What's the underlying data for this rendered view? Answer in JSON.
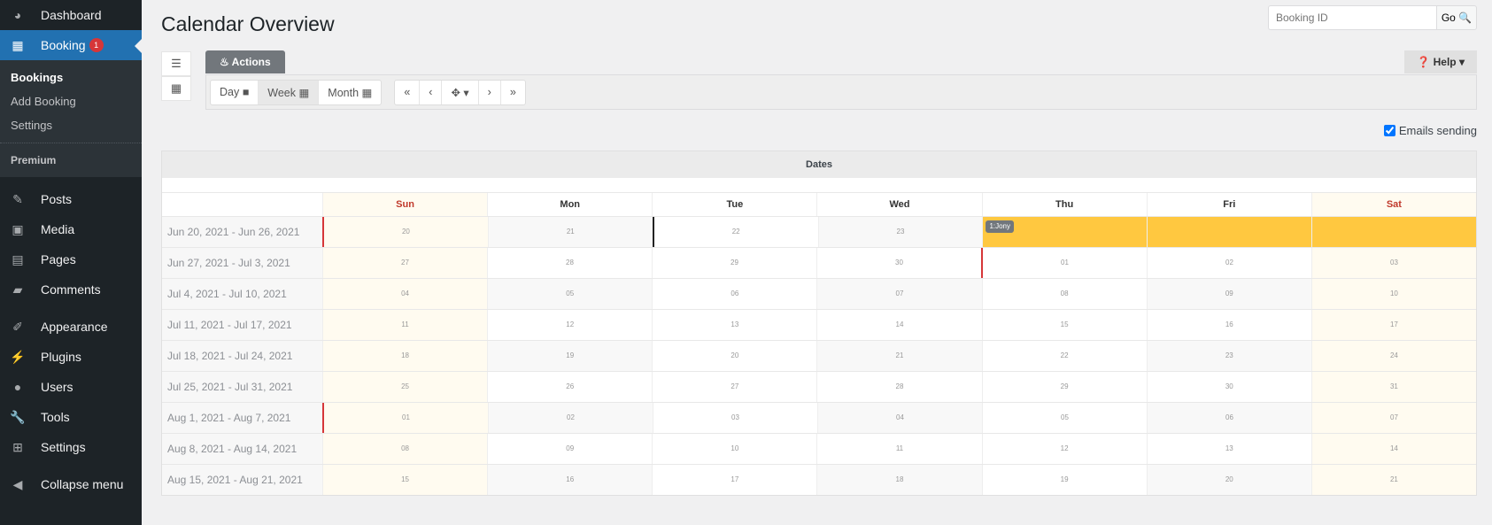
{
  "sidebar": {
    "top": [
      {
        "label": "Dashboard",
        "icon": "dashboard-icon",
        "glyph": "◕"
      }
    ],
    "booking": {
      "label": "Booking",
      "badge": "1"
    },
    "sub": [
      "Bookings",
      "Add Booking",
      "Settings"
    ],
    "premium": "Premium",
    "items": [
      {
        "label": "Posts",
        "glyph": "✎"
      },
      {
        "label": "Media",
        "glyph": "▣"
      },
      {
        "label": "Pages",
        "glyph": "▤"
      },
      {
        "label": "Comments",
        "glyph": "▰"
      },
      {
        "label": "Appearance",
        "glyph": "✐"
      },
      {
        "label": "Plugins",
        "glyph": "⚡"
      },
      {
        "label": "Users",
        "glyph": "●"
      },
      {
        "label": "Tools",
        "glyph": "🔧"
      },
      {
        "label": "Settings",
        "glyph": "⊞"
      },
      {
        "label": "Collapse menu",
        "glyph": "◀"
      }
    ]
  },
  "header": {
    "title": "Calendar Overview",
    "search_placeholder": "Booking ID",
    "go": "Go 🔍"
  },
  "toolbar": {
    "actions": "♨ Actions",
    "help": "❓ Help ▾",
    "views": [
      {
        "label": "Day ■",
        "selected": false
      },
      {
        "label": "Week ▦",
        "selected": true
      },
      {
        "label": "Month ▦",
        "selected": false
      }
    ],
    "nav": [
      "«",
      "‹",
      "✥ ▾",
      "›",
      "»"
    ],
    "emails": "Emails sending",
    "emails_checked": true
  },
  "calendar": {
    "title": "Dates",
    "days": [
      "Sun",
      "Mon",
      "Tue",
      "Wed",
      "Thu",
      "Fri",
      "Sat"
    ],
    "rows": [
      {
        "label": "Jun 20, 2021 - Jun 26, 2021",
        "dates": [
          "20",
          "21",
          "22",
          "23",
          "",
          "",
          ""
        ]
      },
      {
        "label": "Jun 27, 2021 - Jul 3, 2021",
        "dates": [
          "27",
          "28",
          "29",
          "30",
          "01",
          "02",
          "03"
        ]
      },
      {
        "label": "Jul 4, 2021 - Jul 10, 2021",
        "dates": [
          "04",
          "05",
          "06",
          "07",
          "08",
          "09",
          "10"
        ]
      },
      {
        "label": "Jul 11, 2021 - Jul 17, 2021",
        "dates": [
          "11",
          "12",
          "13",
          "14",
          "15",
          "16",
          "17"
        ]
      },
      {
        "label": "Jul 18, 2021 - Jul 24, 2021",
        "dates": [
          "18",
          "19",
          "20",
          "21",
          "22",
          "23",
          "24"
        ]
      },
      {
        "label": "Jul 25, 2021 - Jul 31, 2021",
        "dates": [
          "25",
          "26",
          "27",
          "28",
          "29",
          "30",
          "31"
        ]
      },
      {
        "label": "Aug 1, 2021 - Aug 7, 2021",
        "dates": [
          "01",
          "02",
          "03",
          "04",
          "05",
          "06",
          "07"
        ]
      },
      {
        "label": "Aug 8, 2021 - Aug 14, 2021",
        "dates": [
          "08",
          "09",
          "10",
          "11",
          "12",
          "13",
          "14"
        ]
      },
      {
        "label": "Aug 15, 2021 - Aug 21, 2021",
        "dates": [
          "15",
          "16",
          "17",
          "18",
          "19",
          "20",
          "21"
        ]
      }
    ],
    "booking": {
      "label": "1:Jony",
      "row": 0,
      "from_day": 4,
      "to_day": 6,
      "color": "#ffc840"
    }
  }
}
